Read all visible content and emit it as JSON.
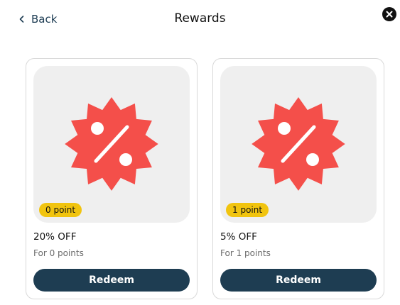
{
  "header": {
    "back_label": "Back",
    "title": "Rewards",
    "close_icon": "close-icon"
  },
  "colors": {
    "accent": "#1e3d52",
    "badge_red": "#f44f4a",
    "pill_yellow": "#f1c40f",
    "image_bg": "#efefef"
  },
  "rewards": [
    {
      "icon": "discount-badge-icon",
      "points_badge": "0 point",
      "title": "20% OFF",
      "subtitle": "For 0 points",
      "button_label": "Redeem"
    },
    {
      "icon": "discount-badge-icon",
      "points_badge": "1 point",
      "title": "5% OFF",
      "subtitle": "For 1 points",
      "button_label": "Redeem"
    }
  ]
}
